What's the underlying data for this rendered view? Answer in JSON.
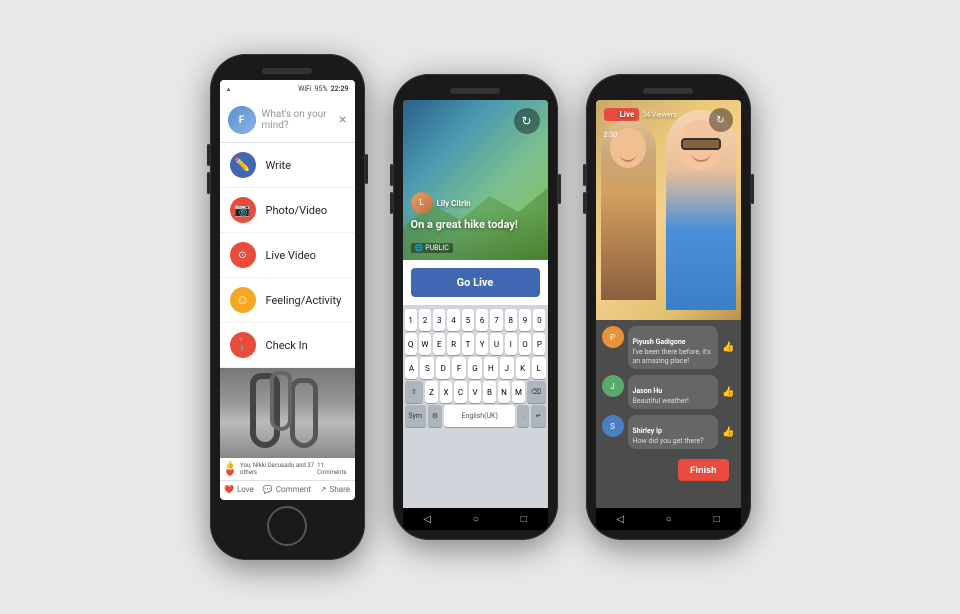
{
  "background": "#e0e0e0",
  "phones": {
    "phone1": {
      "status_bar": {
        "signal": "▲▼",
        "wifi": "WiFi",
        "battery": "95%",
        "time": "22:29"
      },
      "composer": {
        "placeholder": "What's on your mind?",
        "close": "×"
      },
      "menu_items": [
        {
          "id": "write",
          "label": "Write",
          "icon": "✏️",
          "icon_color": "blue"
        },
        {
          "id": "photo-video",
          "label": "Photo/Video",
          "icon": "📷",
          "icon_color": "red-cam"
        },
        {
          "id": "live-video",
          "label": "Live Video",
          "icon": "⊙",
          "icon_color": "red-live"
        },
        {
          "id": "feeling",
          "label": "Feeling/Activity",
          "icon": "☺",
          "icon_color": "yellow"
        },
        {
          "id": "check-in",
          "label": "Check In",
          "icon": "📍",
          "icon_color": "red-pin"
        }
      ],
      "bottom_bar": {
        "reactions": "👍❤️",
        "likes_text": "You, Nikki Decusado and 37 others",
        "comments": "11 Comments"
      },
      "actions": [
        {
          "id": "love",
          "label": "Love",
          "icon": "❤️"
        },
        {
          "id": "comment",
          "label": "Comment",
          "icon": "💬"
        },
        {
          "id": "share",
          "label": "Share",
          "icon": "↗"
        }
      ]
    },
    "phone2": {
      "live_setup": {
        "username": "Lily Citrin",
        "caption": "On a great hike today!",
        "visibility": "PUBLIC",
        "flip_icon": "↻"
      },
      "go_live_button": "Go Live",
      "keyboard": {
        "rows": [
          [
            "1",
            "2",
            "3",
            "4",
            "5",
            "6",
            "7",
            "8",
            "9",
            "0"
          ],
          [
            "Q",
            "W",
            "E",
            "R",
            "T",
            "Y",
            "U",
            "I",
            "O",
            "P"
          ],
          [
            "A",
            "S",
            "D",
            "F",
            "G",
            "H",
            "J",
            "K",
            "L"
          ],
          [
            "Z",
            "X",
            "C",
            "V",
            "B",
            "N",
            "M"
          ],
          [
            "Sym",
            "⚙",
            "English(UK)",
            ".",
            "↵"
          ]
        ],
        "shift": "⇧",
        "backspace": "⌫"
      },
      "nav": {
        "back": "◁",
        "home": "○",
        "recents": "□"
      }
    },
    "phone3": {
      "live_stream": {
        "status": "Live",
        "dot": "●",
        "viewers": "34 Viewers",
        "timer": "2:30",
        "flip_icon": "↻"
      },
      "comments": [
        {
          "id": "comment1",
          "avatar_color": "#e8923a",
          "name": "Piyush Gadigone",
          "text": "I've been there before, it's an amazing place!",
          "liked": true
        },
        {
          "id": "comment2",
          "avatar_color": "#5aaa70",
          "name": "Jason Hu",
          "text": "Beautiful weather!",
          "liked": false
        },
        {
          "id": "comment3",
          "avatar_color": "#4a7fc0",
          "name": "Shirley Ip",
          "text": "How did you get there?",
          "liked": false
        }
      ],
      "finish_button": "Finish",
      "nav": {
        "back": "◁",
        "home": "○",
        "recents": "□"
      }
    }
  }
}
